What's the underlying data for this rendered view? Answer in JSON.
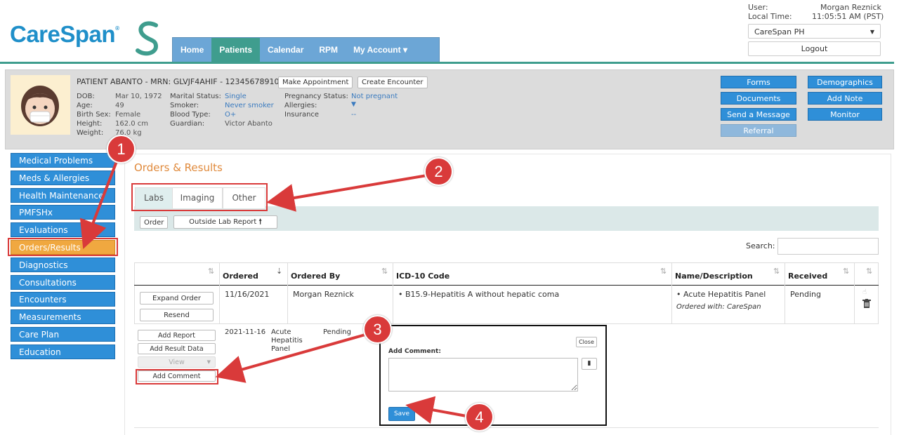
{
  "header": {
    "logo_text": "CareSpan",
    "logo_reg": "®",
    "nav": [
      "Home",
      "Patients",
      "Calendar",
      "RPM",
      "My Account ▾"
    ],
    "user_label": "User:",
    "user_name": "Morgan Reznick",
    "local_time_label": "Local Time:",
    "local_time": "11:05:51 AM (PST)",
    "practice": "CareSpan PH",
    "logout": "Logout",
    "colors": {
      "brand": "#1f8fc9",
      "nav_bg": "#6ca6d6",
      "nav_active": "#3f9d8e"
    }
  },
  "patient": {
    "title": "PATIENT ABANTO - MRN: GLVJF4AHIF - 12345678910",
    "make_appointment": "Make Appointment",
    "create_encounter": "Create Encounter",
    "col1": [
      [
        "DOB:",
        "Mar 10, 1972"
      ],
      [
        "Age:",
        "49"
      ],
      [
        "Birth Sex:",
        "Female"
      ],
      [
        "Height:",
        "162.0 cm"
      ],
      [
        "Weight:",
        "76.0 kg"
      ]
    ],
    "col2": [
      [
        "Marital Status:",
        "Single"
      ],
      [
        "Smoker:",
        "Never smoker"
      ],
      [
        "Blood Type:",
        "O+"
      ],
      [
        "Guardian:",
        "Victor Abanto"
      ]
    ],
    "col3": [
      [
        "Pregnancy Status:",
        "Not pregnant"
      ],
      [
        "Allergies:",
        ""
      ],
      [
        "Insurance",
        "--"
      ]
    ],
    "actions": [
      "Forms",
      "Documents",
      "Send a Message",
      "Referral",
      "Demographics",
      "Add Note",
      "Monitor"
    ]
  },
  "sidebar": {
    "items": [
      "Medical Problems",
      "Meds & Allergies",
      "Health Maintenance",
      "PMFSHx",
      "Evaluations",
      "Orders/Results",
      "Diagnostics",
      "Consultations",
      "Encounters",
      "Measurements",
      "Care Plan",
      "Education"
    ]
  },
  "main": {
    "title": "Orders & Results",
    "tabs": [
      "Labs",
      "Imaging",
      "Other"
    ],
    "order_button": "Order",
    "outside_report": "Outside Lab Report",
    "search_label": "Search:",
    "columns": [
      "",
      "Ordered",
      "Ordered By",
      "ICD-10 Code",
      "Name/Description",
      "Received",
      ""
    ],
    "row": {
      "expand": "Expand Order",
      "resend": "Resend",
      "ordered": "11/16/2021",
      "ordered_by": "Morgan Reznick",
      "icd": "B15.9-Hepatitis A without hepatic coma",
      "name": "Acute Hepatitis Panel",
      "ordered_with": "Ordered with: CareSpan",
      "received": "Pending"
    },
    "sub": {
      "add_report": "Add Report",
      "add_result": "Add Result Data",
      "view": "View",
      "add_comment": "Add Comment",
      "date": "2021-11-16",
      "panel_lines": [
        "Acute",
        "Hepatitis",
        "Panel"
      ],
      "status": "Pending"
    },
    "popup": {
      "label": "Add Comment:",
      "close": "Close",
      "save": "Save"
    }
  },
  "callouts": [
    "1",
    "2",
    "3",
    "4"
  ]
}
